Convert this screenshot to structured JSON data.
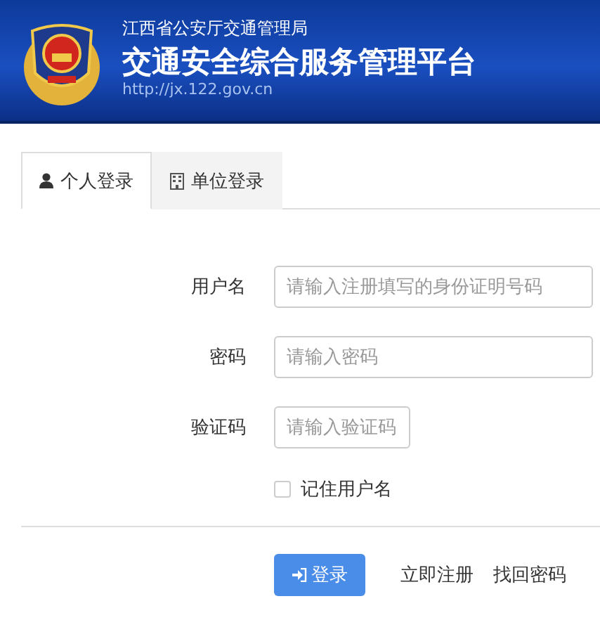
{
  "header": {
    "subtitle": "江西省公安厅交通管理局",
    "title": "交通安全综合服务管理平台",
    "url": "http://jx.122.gov.cn"
  },
  "tabs": [
    {
      "label": "个人登录",
      "kind": "personal",
      "selected": true
    },
    {
      "label": "单位登录",
      "kind": "organization",
      "selected": false
    }
  ],
  "fields": [
    {
      "label": "用户名",
      "placeholder": "请输入注册填写的身份证明号码",
      "kind": "wide"
    },
    {
      "label": "密码",
      "placeholder": "请输入密码",
      "kind": "password"
    },
    {
      "label": "验证码",
      "placeholder": "请输入验证码",
      "kind": "captcha"
    }
  ],
  "remember": {
    "label": "记住用户名",
    "checked": false
  },
  "login_button": "登录",
  "links": [
    "立即注册",
    "找回密码"
  ]
}
